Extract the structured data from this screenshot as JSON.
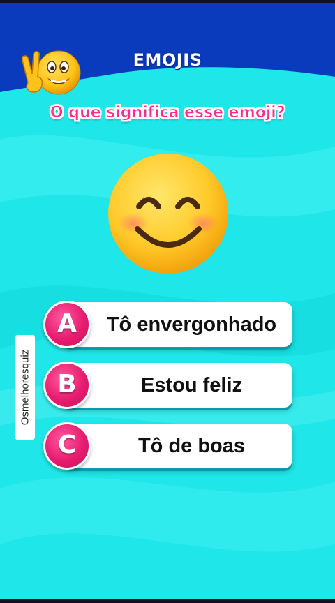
{
  "header": {
    "title": "EMOJIS"
  },
  "question": {
    "text": "O que significa esse emoji?"
  },
  "options": [
    {
      "letter": "A",
      "label": "Tô envergonhado"
    },
    {
      "letter": "B",
      "label": "Estou feliz"
    },
    {
      "letter": "C",
      "label": "Tô de boas"
    }
  ],
  "watermark": {
    "text": "Osmelhoresquiz"
  },
  "colors": {
    "background": "#1fe6e8",
    "header_blue": "#0a3bbd",
    "question_pink": "#ff2a8c",
    "badge_pink": "#e81c70"
  },
  "icons": {
    "mascot": "peace-sign-emoji-icon",
    "question_emoji": "smiling-face-with-smiling-eyes-icon"
  }
}
